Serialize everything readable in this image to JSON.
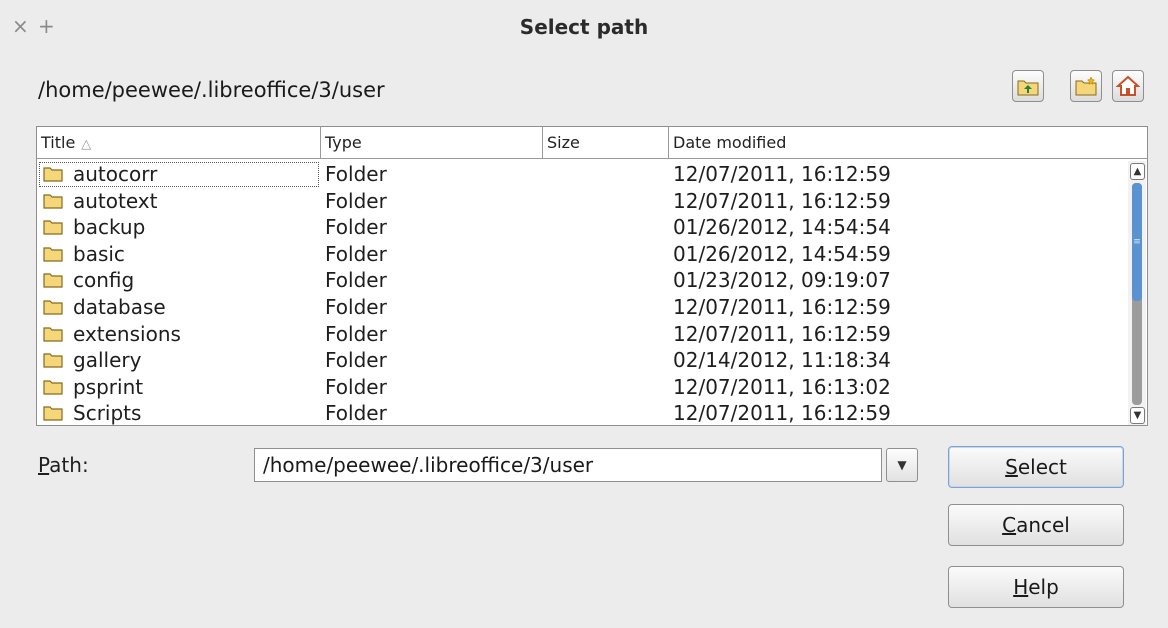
{
  "window": {
    "title": "Select path",
    "close_glyph": "×",
    "max_glyph": "+"
  },
  "current_path": "/home/peewee/.libreoffice/3/user",
  "toolbar": {
    "up_icon": "folder-up-icon",
    "new_folder_icon": "new-folder-icon",
    "home_icon": "home-icon"
  },
  "list": {
    "columns": {
      "title": "Title",
      "type": "Type",
      "size": "Size",
      "date": "Date modified"
    },
    "sort_glyph": "△",
    "rows": [
      {
        "title": "autocorr",
        "type": "Folder",
        "date": "12/07/2011, 16:12:59"
      },
      {
        "title": "autotext",
        "type": "Folder",
        "date": "12/07/2011, 16:12:59"
      },
      {
        "title": "backup",
        "type": "Folder",
        "date": "01/26/2012, 14:54:54"
      },
      {
        "title": "basic",
        "type": "Folder",
        "date": "01/26/2012, 14:54:59"
      },
      {
        "title": "config",
        "type": "Folder",
        "date": "01/23/2012, 09:19:07"
      },
      {
        "title": "database",
        "type": "Folder",
        "date": "12/07/2011, 16:12:59"
      },
      {
        "title": "extensions",
        "type": "Folder",
        "date": "12/07/2011, 16:12:59"
      },
      {
        "title": "gallery",
        "type": "Folder",
        "date": "02/14/2012, 11:18:34"
      },
      {
        "title": "psprint",
        "type": "Folder",
        "date": "12/07/2011, 16:13:02"
      },
      {
        "title": "Scripts",
        "type": "Folder",
        "date": "12/07/2011, 16:12:59"
      }
    ]
  },
  "path_field": {
    "label_mnemonic": "P",
    "label_rest": "ath:",
    "value": "/home/peewee/.libreoffice/3/user"
  },
  "buttons": {
    "select": {
      "mnemonic": "S",
      "rest": "elect"
    },
    "cancel": {
      "mnemonic": "C",
      "rest": "ancel"
    },
    "help": {
      "mnemonic": "H",
      "rest": "elp"
    }
  },
  "colors": {
    "folder": "#f3d77a",
    "folder_edge": "#8a6a1c",
    "scroll_thumb": "#5a93d0",
    "home_roof": "#c8502a"
  }
}
